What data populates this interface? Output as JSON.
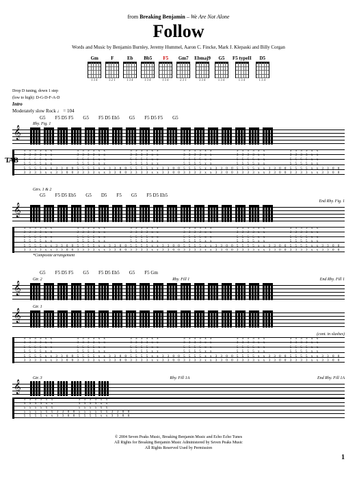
{
  "header": {
    "from_prefix": "from",
    "artist": "Breaking Benjamin",
    "album": "We Are Not Alone"
  },
  "title": "Follow",
  "credits": "Words and Music by Benjamin Burnley, Jeremy Hummel, Aaron C. Fincke, Mark J. Klepaski and Billy Corgan",
  "chords": [
    {
      "nm": "Gm",
      "fng": "134"
    },
    {
      "nm": "F",
      "fng": "321"
    },
    {
      "nm": "Eb",
      "fng": "134"
    },
    {
      "nm": "Bb5",
      "fng": "134"
    },
    {
      "nm": "F5",
      "fng": "134",
      "highlight": true
    },
    {
      "nm": "Gm7",
      "fng": "231"
    },
    {
      "nm": "Ebmaj9",
      "fng": "334"
    },
    {
      "nm": "G5",
      "fng": "134"
    },
    {
      "nm": "F5 typeII",
      "fng": "134"
    },
    {
      "nm": "D5",
      "fng": "134"
    }
  ],
  "tuning": {
    "label": "Drop D tuning, down 1 step",
    "detail": "(low to high): D-G-D-F-A-D"
  },
  "intro": {
    "label": "Intro",
    "tempo": "Moderately slow Rock ♩ = 104"
  },
  "system1": {
    "chords": [
      "G5",
      "F5 D5 F5",
      "G5",
      "F5 D5 Eb5",
      "G5",
      "F5 D5 F5",
      "G5"
    ],
    "rhyfig": "Rhy. Fig. 1",
    "tab_lbl": "TAB"
  },
  "system2": {
    "gtrs": "Gtrs. 1 & 2",
    "chords": [
      "G5",
      "F5 D5 Eb5",
      "G5",
      "D5",
      "F5",
      "G5",
      "F5 D5 Eb5"
    ],
    "rhyfig": "End Rhy. Fig. 1",
    "note": "*Composite arrangement"
  },
  "system3": {
    "chords": [
      "G5",
      "F5 D5 F5",
      "G5",
      "F5 D5 Eb5",
      "G5",
      "F5 Gm"
    ],
    "rhyfig": "End Rhy. Fill 1",
    "rhyfig_start": "Rhy. Fill 1",
    "gtr2": "Gtr. 2",
    "gtr1": "Gtr. 1",
    "annotation": "(cont. in slashes)"
  },
  "system4": {
    "rhyfig_start": "Rhy. Fill 1A",
    "rhyfig_end": "End Rhy. Fill 1A",
    "gtr3": "Gtr. 3"
  },
  "tab_cols": [
    [
      "3",
      "3",
      "5",
      "5",
      "5",
      "3"
    ],
    [
      "3",
      "3",
      "5",
      "5",
      "5",
      "3"
    ],
    [
      "3",
      "3",
      "5",
      "5",
      "5",
      "3"
    ],
    [
      "3",
      "3",
      "5",
      "5",
      "5",
      "3"
    ],
    [
      "x",
      "x",
      "x",
      "x",
      "x",
      "x"
    ],
    [
      "x",
      "x",
      "x",
      "x",
      "x",
      "x"
    ],
    [
      "",
      "",
      "",
      "",
      "3",
      "3"
    ],
    [
      "",
      "",
      "",
      "",
      "3",
      "3"
    ],
    [
      "",
      "",
      "",
      "",
      "0",
      "0"
    ],
    [
      "",
      "",
      "",
      "",
      "0",
      "0"
    ]
  ],
  "footer": {
    "c1": "© 2004 Seven Peaks Music, Breaking Benjamin Music and Echo Echo Tunes",
    "c2": "All Rights for Breaking Benjamin Music Administered by Seven Peaks Music",
    "c3": "All Rights Reserved   Used by Permission"
  },
  "page": "1"
}
